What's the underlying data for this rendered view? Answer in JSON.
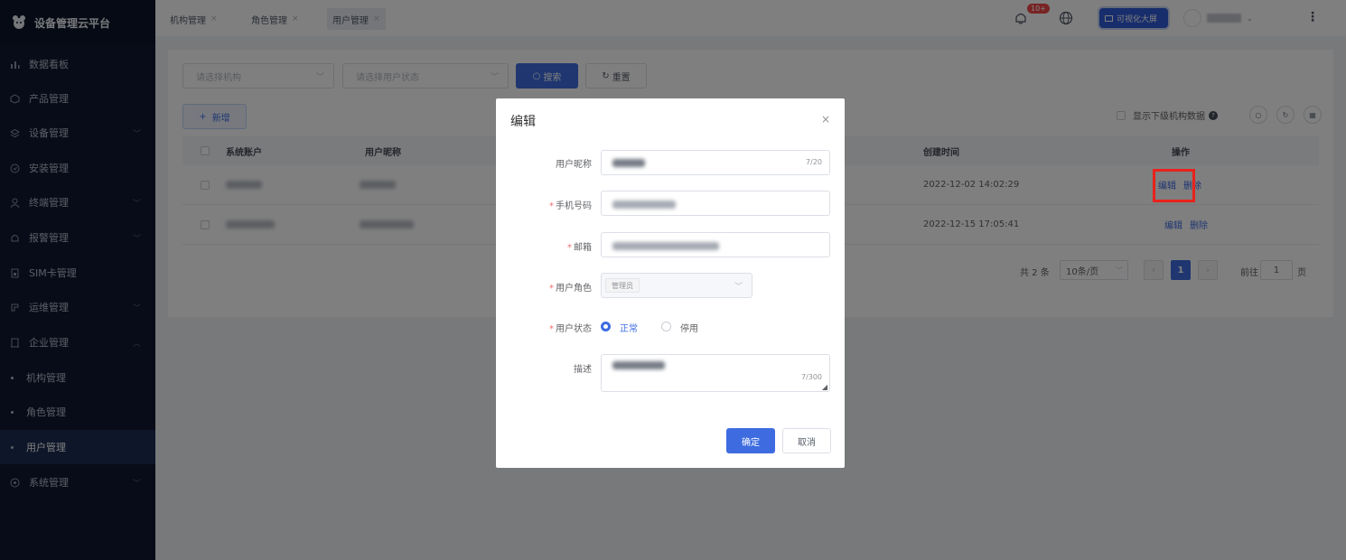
{
  "app": {
    "title": "设备管理云平台",
    "logo_icon": "gear-bear-logo"
  },
  "sidebar": {
    "items": [
      {
        "label": "数据看板",
        "icon": "bar-chart-icon",
        "chevron": false
      },
      {
        "label": "产品管理",
        "icon": "cube-icon",
        "chevron": false
      },
      {
        "label": "设备管理",
        "icon": "layers-icon",
        "chevron": true
      },
      {
        "label": "安装管理",
        "icon": "settings-circle-icon",
        "chevron": false
      },
      {
        "label": "终端管理",
        "icon": "user-icon",
        "chevron": true
      },
      {
        "label": "报警管理",
        "icon": "alarm-icon",
        "chevron": true
      },
      {
        "label": "SIM卡管理",
        "icon": "sim-card-icon",
        "chevron": false
      },
      {
        "label": "运维管理",
        "icon": "tools-icon",
        "chevron": true
      },
      {
        "label": "企业管理",
        "icon": "building-icon",
        "chevron": true,
        "expanded": true
      },
      {
        "label": "机构管理",
        "sub": true
      },
      {
        "label": "角色管理",
        "sub": true
      },
      {
        "label": "用户管理",
        "sub": true,
        "active": true
      },
      {
        "label": "系统管理",
        "icon": "system-icon",
        "chevron": true
      }
    ]
  },
  "header": {
    "tabs": [
      {
        "label": "机构管理",
        "close": "×"
      },
      {
        "label": "角色管理",
        "close": "×"
      },
      {
        "label": "用户管理",
        "close": "×",
        "active": true
      }
    ],
    "notification_badge": "10+",
    "bigscreen_label": "可视化大屏",
    "more": "⋮"
  },
  "filters": {
    "org_placeholder": "请选择机构",
    "status_placeholder": "请选择用户状态",
    "search_label": "搜索",
    "reset_label": "重置",
    "add_label": "新增",
    "show_sub_label": "显示下级机构数据"
  },
  "table": {
    "columns": {
      "account": "系统账户",
      "nickname": "用户昵称",
      "created": "创建时间",
      "actions": "操作"
    },
    "rows": [
      {
        "created": "2022-12-02 14:02:29",
        "edit": "编辑",
        "delete": "删除"
      },
      {
        "created": "2022-12-15 17:05:41",
        "edit": "编辑",
        "delete": "删除"
      }
    ]
  },
  "pagination": {
    "total": "共 2 条",
    "page_size": "10条/页",
    "current_page": "1",
    "goto_label": "前往",
    "goto_value": "1",
    "page_unit": "页"
  },
  "modal": {
    "title": "编辑",
    "close": "×",
    "nickname_label": "用户昵称",
    "nickname_count": "7/20",
    "phone_label": "手机号码",
    "email_label": "邮箱",
    "role_label": "用户角色",
    "role_value": "管理员",
    "status_label": "用户状态",
    "status_normal": "正常",
    "status_disabled": "停用",
    "desc_label": "描述",
    "desc_count": "7/300",
    "confirm": "确定",
    "cancel": "取消"
  },
  "colors": {
    "primary": "#3e6ce0",
    "sidebar": "#0f1831",
    "highlight": "#e8221b"
  }
}
